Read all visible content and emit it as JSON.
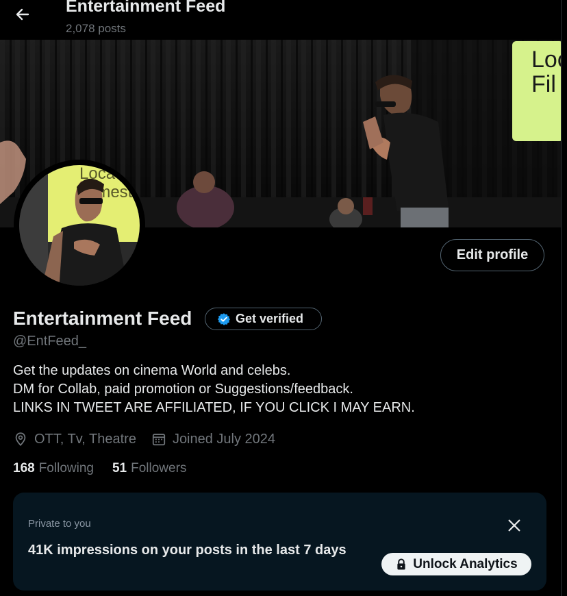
{
  "header": {
    "title": "Entertainment Feed",
    "post_count": "2,078 posts"
  },
  "banner": {
    "sign_text": "Loc Fil",
    "avatar_sign_text": "Loca Filmest"
  },
  "profile": {
    "display_name": "Entertainment Feed",
    "handle": "@EntFeed_",
    "edit_button_label": "Edit profile",
    "get_verified_label": "Get verified",
    "bio_lines": [
      "Get the updates on cinema World and celebs.",
      "DM for Collab, paid promotion or Suggestions/feedback.",
      "LINKS IN TWEET ARE AFFILIATED, IF YOU CLICK I MAY EARN."
    ],
    "location": "OTT, Tv, Theatre",
    "joined": "Joined July 2024",
    "following_count": "168",
    "following_label": "Following",
    "followers_count": "51",
    "followers_label": "Followers"
  },
  "analytics_card": {
    "private_label": "Private to you",
    "impressions_text": "41K impressions on your posts in the last 7 days",
    "unlock_label": "Unlock Analytics"
  },
  "icons": {
    "back": "arrow-left-icon",
    "verified": "verified-badge-icon",
    "location": "location-pin-icon",
    "calendar": "calendar-icon",
    "close": "close-icon",
    "lock": "lock-icon"
  },
  "colors": {
    "background": "#000000",
    "text_primary": "#e7e9ea",
    "text_secondary": "#71767b",
    "verified_blue": "#1d9bf0",
    "card_bg": "#061620",
    "button_light": "#eff3f4",
    "banner_sign_green": "#d6f28c"
  }
}
